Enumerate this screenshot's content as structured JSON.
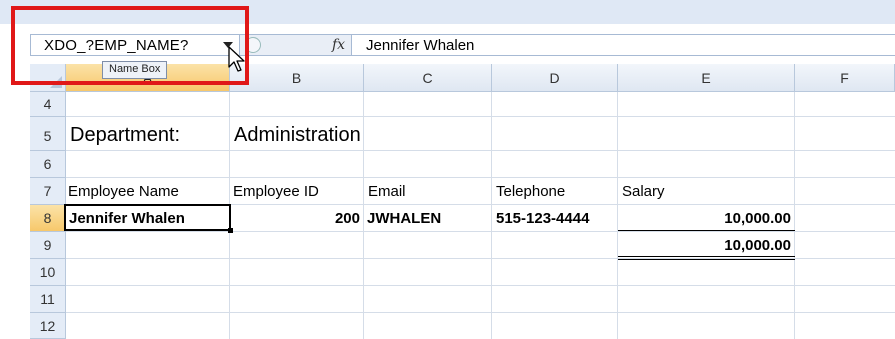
{
  "formula_bar": {
    "name_box_value": "XDO_?EMP_NAME?",
    "fx_label": "fx",
    "formula_value": "Jennifer Whalen"
  },
  "tooltip": "Name Box",
  "columns": [
    "A",
    "B",
    "C",
    "D",
    "E",
    "F"
  ],
  "rows": [
    "4",
    "5",
    "6",
    "7",
    "8",
    "9",
    "10",
    "11",
    "12"
  ],
  "cells": {
    "department_label": "Department:",
    "department_value": "Administration",
    "headers": [
      "Employee Name",
      "Employee ID",
      "Email",
      "Telephone",
      "Salary"
    ],
    "employee_name": "Jennifer Whalen",
    "employee_id": "200",
    "email": "JWHALEN",
    "telephone": "515-123-4444",
    "salary": "10,000.00",
    "total_salary": "10,000.00"
  },
  "colors": {
    "highlight": "#e01818",
    "active_header": "#f7c86b",
    "header_bg": "#e4ecf7",
    "gridline": "#d5dde8"
  }
}
